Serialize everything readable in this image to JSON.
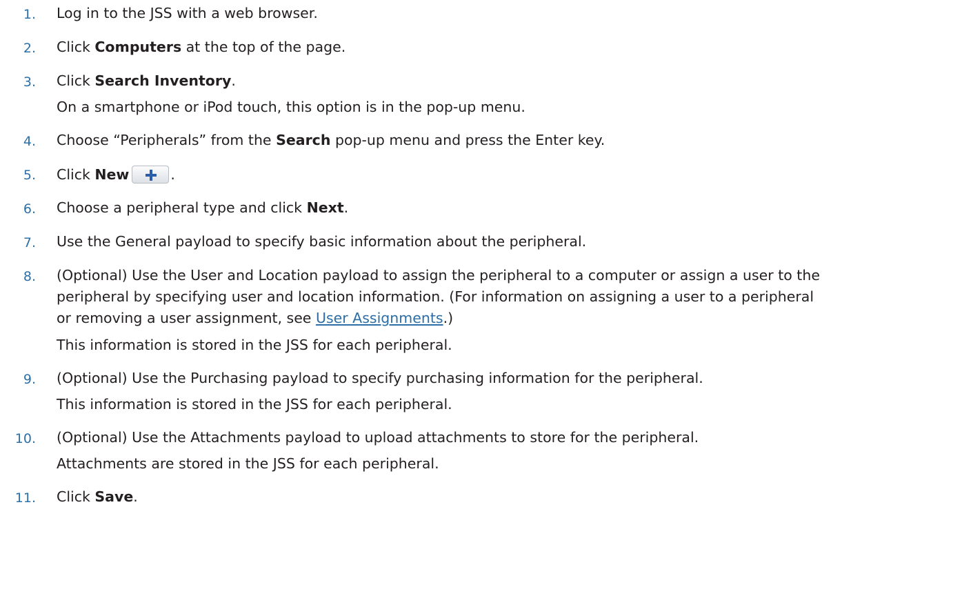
{
  "steps": [
    {
      "num": "1.",
      "text": "Log in to the JSS with a web browser."
    },
    {
      "num": "2.",
      "pre": "Click ",
      "bold": "Computers",
      "post": " at the top of the page."
    },
    {
      "num": "3.",
      "pre": "Click ",
      "bold": "Search Inventory",
      "post": ".",
      "sub": "On a smartphone or iPod touch, this option is in the pop-up menu."
    },
    {
      "num": "4.",
      "pre": "Choose “Peripherals” from the ",
      "bold": "Search",
      "post": " pop-up menu and press the Enter key."
    },
    {
      "num": "5.",
      "pre": "Click ",
      "bold": "New",
      "post": "."
    },
    {
      "num": "6.",
      "pre": "Choose a peripheral type and click ",
      "bold": "Next",
      "post": "."
    },
    {
      "num": "7.",
      "text": "Use the General payload to specify basic information about the peripheral."
    },
    {
      "num": "8.",
      "line1": "(Optional) Use the User and Location payload to assign the peripheral to a computer or assign a user to the",
      "line2": "peripheral by specifying user and location information. (For information on assigning a user to a peripheral",
      "line3_pre": "or removing a user assignment, see ",
      "link": "User Assignments",
      "line3_post": ".)",
      "sub": "This information is stored in the JSS for each peripheral."
    },
    {
      "num": "9.",
      "text": "(Optional) Use the Purchasing payload to specify purchasing information for the peripheral.",
      "sub": "This information is stored in the JSS for each peripheral."
    },
    {
      "num": "10.",
      "text": "(Optional) Use the Attachments payload to upload attachments to store for the peripheral.",
      "sub": "Attachments are stored in the JSS for each peripheral."
    },
    {
      "num": "11.",
      "pre": "Click ",
      "bold": "Save",
      "post": "."
    }
  ],
  "icons": {
    "new_button_icon": "plus-icon",
    "accent": "#2e6fa6",
    "plus_color": "#2b5ea8"
  }
}
